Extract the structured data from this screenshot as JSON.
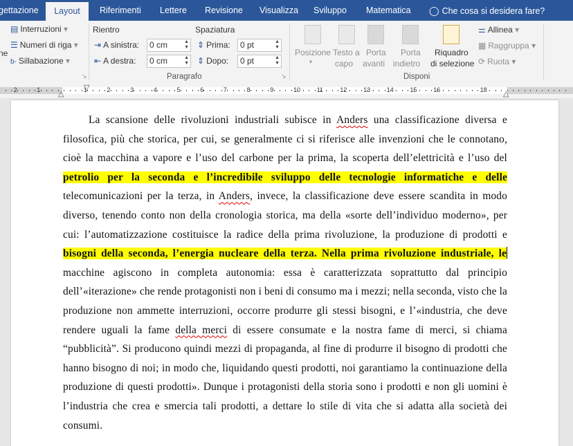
{
  "tabs": [
    {
      "label": "gettazione",
      "active": false
    },
    {
      "label": "Layout",
      "active": true
    },
    {
      "label": "Riferimenti",
      "active": false
    },
    {
      "label": "Lettere",
      "active": false
    },
    {
      "label": "Revisione",
      "active": false
    },
    {
      "label": "Visualizza",
      "active": false
    },
    {
      "label": "Sviluppo",
      "active": false
    },
    {
      "label": "Matematica",
      "active": false
    }
  ],
  "tell_me": "Che cosa si desidera fare?",
  "ribbon": {
    "setup": {
      "breaks": "Interruzioni",
      "line_numbers": "Numeri di riga",
      "hyphenation": "Sillabazione",
      "partial_label": "ne"
    },
    "paragraph": {
      "group_label": "Paragrafo",
      "indent_title": "Rientro",
      "spacing_title": "Spaziatura",
      "left_label": "A sinistra:",
      "left_value": "0 cm",
      "right_label": "A destra:",
      "right_value": "0 cm",
      "before_label": "Prima:",
      "before_value": "0 pt",
      "after_label": "Dopo:",
      "after_value": "0 pt"
    },
    "arrange": {
      "group_label": "Disponi",
      "position": "Posizione",
      "wrap_1": "Testo a",
      "wrap_2": "capo",
      "forward_1": "Porta",
      "forward_2": "avanti",
      "backward_1": "Porta",
      "backward_2": "indietro",
      "selection_1": "Riquadro",
      "selection_2": "di selezione",
      "align": "Allinea",
      "group": "Raggruppa",
      "rotate": "Ruota"
    }
  },
  "ruler": {
    "left_numbers": [
      "2",
      "1"
    ],
    "right_numbers": [
      "1",
      "2",
      "3",
      "4",
      "5",
      "6",
      "7",
      "8",
      "9",
      "10",
      "11",
      "12",
      "13",
      "14",
      "15",
      "16",
      "18"
    ]
  },
  "document": {
    "runs": [
      {
        "t": "La scansione delle rivoluzioni industriali subisce in ",
        "s": ""
      },
      {
        "t": "Anders",
        "s": "sq"
      },
      {
        "t": " una classificazione diversa e filosofica, più che storica, per cui, se generalmente ci si riferisce alle invenzioni che le connotano, cioè la macchina a vapore e l’uso del carbone per la prima, la scoperta dell’elettricità e l’uso del ",
        "s": ""
      },
      {
        "t": "petrolio per la seconda e l’incredibile sviluppo delle tecnologie informatiche e delle",
        "s": "hl"
      },
      {
        "t": " telecomunicazioni per la terza, in ",
        "s": ""
      },
      {
        "t": "Anders",
        "s": "sq"
      },
      {
        "t": ", invece, la classificazione deve essere scandita in modo diverso, tenendo conto non della cronologia storica, ma della «sorte dell’individuo moderno», per cui: l’automatizzazione costituisce la radice della prima rivoluzione, la produzione di prodotti e ",
        "s": ""
      },
      {
        "t": "bisogni della seconda, l’energia nucleare della terza. Nella prima rivoluzione industriale, le",
        "s": "hl"
      },
      {
        "t": "",
        "s": "caret"
      },
      {
        "t": " macchine agiscono in completa autonomia: essa è caratterizzata soprattutto dal principio dell’«iterazione» che rende protagonisti non i beni di consumo ma i mezzi; nella seconda, visto che la produzione non ammette interruzioni, occorre produrre gli stessi bisogni, e l’«industria, che deve rendere uguali la fame ",
        "s": ""
      },
      {
        "t": "della merci",
        "s": "sq"
      },
      {
        "t": " di essere consumate e la nostra fame di merci, si chiama “pubblicità”. Si producono quindi mezzi di propaganda, al fine di produrre il bisogno di prodotti che hanno bisogno di noi; in modo che, liquidando questi prodotti, noi garantiamo la continuazione della produzione di questi prodotti». Dunque i protagonisti della storia sono i prodotti e non gli uomini è l’industria che crea e smercia tali prodotti, a dettare lo stile di vita che si adatta alla società dei consumi.",
        "s": ""
      }
    ]
  },
  "colors": {
    "brand": "#2b579a",
    "highlight": "#ffff00",
    "ribbon_bg": "#f3f3f3"
  }
}
